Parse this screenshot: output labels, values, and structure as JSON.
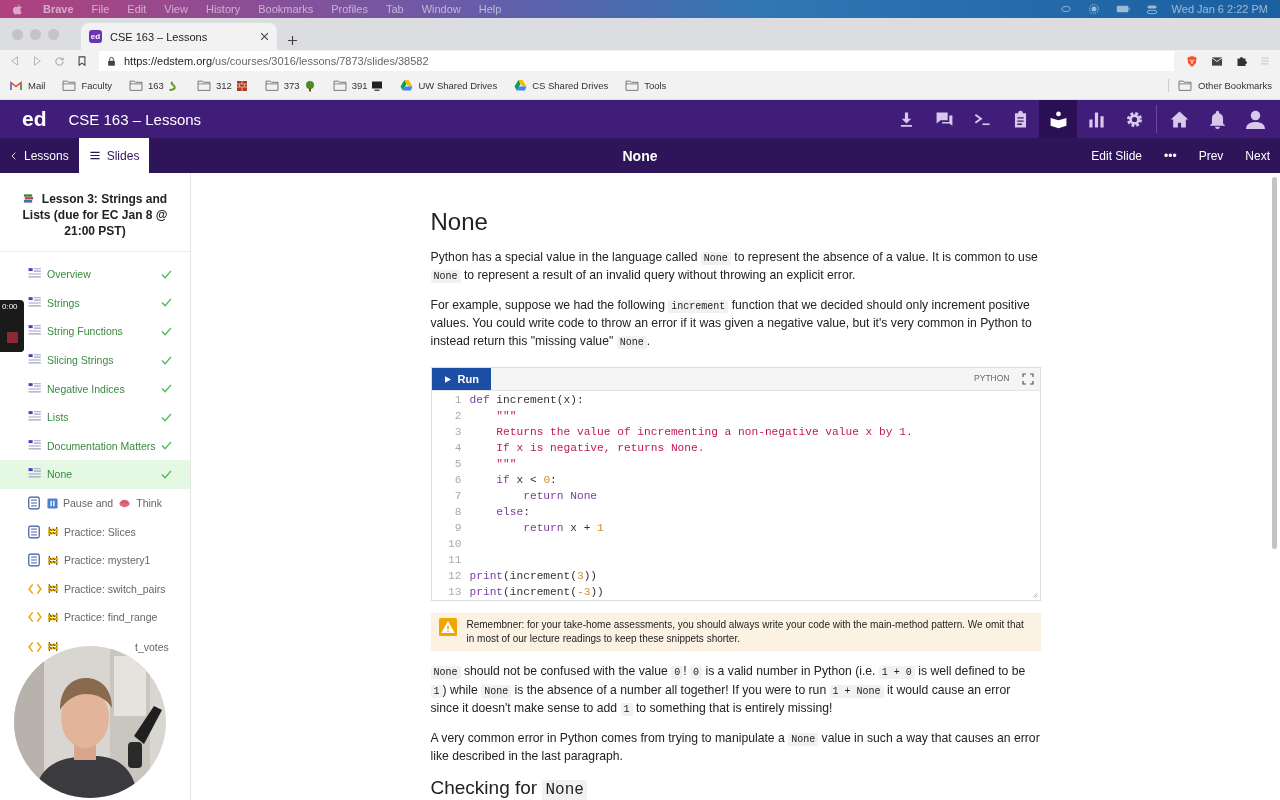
{
  "menu_bar": {
    "app": "Brave",
    "menus": [
      "File",
      "Edit",
      "View",
      "History",
      "Bookmarks",
      "Profiles",
      "Tab",
      "Window",
      "Help"
    ],
    "clock": "Wed Jan 6  2:22 PM"
  },
  "browser": {
    "tab": {
      "favicon": "ed",
      "title": "CSE 163 – Lessons"
    },
    "url_host": "https://edstem.org",
    "url_path": "/us/courses/3016/lessons/7873/slides/38582",
    "bookmarks": [
      {
        "kind": "gmail",
        "label": "Mail"
      },
      {
        "kind": "folder",
        "label": "Faculty"
      },
      {
        "kind": "snake_folder",
        "label": "163"
      },
      {
        "kind": "bricks_folder",
        "label": "312"
      },
      {
        "kind": "tree_folder",
        "label": "373"
      },
      {
        "kind": "monitor_folder",
        "label": "391"
      },
      {
        "kind": "drive",
        "label": "UW Shared Drives"
      },
      {
        "kind": "drive",
        "label": "CS Shared Drives"
      },
      {
        "kind": "folder",
        "label": "Tools"
      }
    ],
    "other_bookmarks": "Other Bookmarks"
  },
  "app_header": {
    "logo": "ed",
    "title": "CSE 163 – Lessons",
    "tools": [
      {
        "kind": "download",
        "selected": false
      },
      {
        "kind": "chat",
        "selected": false
      },
      {
        "kind": "terminal",
        "selected": false
      },
      {
        "kind": "clipboard",
        "selected": false
      },
      {
        "kind": "lessons",
        "selected": true
      },
      {
        "kind": "chart",
        "selected": false
      },
      {
        "kind": "settings",
        "selected": false
      },
      {
        "kind": "home",
        "selected": false
      },
      {
        "kind": "bell",
        "selected": false
      },
      {
        "kind": "user",
        "selected": false
      }
    ]
  },
  "subnav": {
    "back": "Lessons",
    "slides": {
      "label": "Slides",
      "selected": true
    },
    "title": "None",
    "actions": [
      "Edit Slide",
      "•••",
      "Prev",
      "Next"
    ]
  },
  "sidebar": {
    "title": "Lesson 3: Strings and Lists (due for EC Jan 8 @ 21:00 PST)",
    "items": [
      {
        "kind": "slide",
        "parts": [
          {
            "kind": "text",
            "text": "Overview"
          }
        ],
        "done": true,
        "selected": false
      },
      {
        "kind": "slide",
        "parts": [
          {
            "kind": "text",
            "text": "Strings"
          }
        ],
        "done": true,
        "selected": false
      },
      {
        "kind": "slide",
        "parts": [
          {
            "kind": "text",
            "text": "String Functions"
          }
        ],
        "done": true,
        "selected": false
      },
      {
        "kind": "slide",
        "parts": [
          {
            "kind": "text",
            "text": "Slicing Strings"
          }
        ],
        "done": true,
        "selected": false
      },
      {
        "kind": "slide",
        "parts": [
          {
            "kind": "text",
            "text": "Negative Indices"
          }
        ],
        "done": true,
        "selected": false
      },
      {
        "kind": "slide",
        "parts": [
          {
            "kind": "text",
            "text": "Lists"
          }
        ],
        "done": true,
        "selected": false
      },
      {
        "kind": "slide",
        "parts": [
          {
            "kind": "text",
            "text": "Documentation Matters"
          }
        ],
        "done": true,
        "selected": false
      },
      {
        "kind": "slide",
        "parts": [
          {
            "kind": "text",
            "text": "None"
          }
        ],
        "done": true,
        "selected": true
      },
      {
        "kind": "quiz",
        "parts": [
          {
            "kind": "pause"
          },
          {
            "kind": "text",
            "text": "Pause and"
          },
          {
            "kind": "brain"
          },
          {
            "kind": "text",
            "text": "Think"
          }
        ],
        "done": false,
        "selected": false
      },
      {
        "kind": "quiz",
        "parts": [
          {
            "kind": "barrier"
          },
          {
            "kind": "text",
            "text": "Practice: Slices"
          }
        ],
        "done": false,
        "selected": false
      },
      {
        "kind": "quiz",
        "parts": [
          {
            "kind": "barrier"
          },
          {
            "kind": "text",
            "text": "Practice: mystery1"
          }
        ],
        "done": false,
        "selected": false
      },
      {
        "kind": "code",
        "parts": [
          {
            "kind": "barrier"
          },
          {
            "kind": "text",
            "text": "Practice: switch_pairs"
          }
        ],
        "done": false,
        "selected": false
      },
      {
        "kind": "code",
        "parts": [
          {
            "kind": "barrier"
          },
          {
            "kind": "text",
            "text": "Practice: find_range"
          }
        ],
        "done": false,
        "selected": false
      },
      {
        "kind": "code",
        "parts": [
          {
            "kind": "barrier"
          },
          {
            "kind": "gap"
          },
          {
            "kind": "text",
            "text": "t_votes"
          }
        ],
        "done": false,
        "selected": false
      }
    ]
  },
  "recorder": {
    "time": "0:00"
  },
  "content": {
    "heading": "None",
    "blocks": [
      {
        "kind": "paragraph",
        "segments": [
          {
            "kind": "text",
            "text": "Python has a special value in the language called "
          },
          {
            "kind": "code",
            "text": "None"
          },
          {
            "kind": "text",
            "text": " to represent the absence of a value. It is common to use "
          },
          {
            "kind": "code",
            "text": "None"
          },
          {
            "kind": "text",
            "text": " to represent a result of an invalid query without throwing an explicit error."
          }
        ]
      },
      {
        "kind": "paragraph",
        "segments": [
          {
            "kind": "text",
            "text": "For example, suppose we had the following "
          },
          {
            "kind": "code",
            "text": "increment"
          },
          {
            "kind": "text",
            "text": " function that we decided should only increment positive values. You could write code to throw an error if it was given a negative value, but it's very common in Python to instead return this \"missing value\" "
          },
          {
            "kind": "code",
            "text": "None"
          },
          {
            "kind": "text",
            "text": "."
          }
        ]
      },
      {
        "kind": "code",
        "run": "Run",
        "language": "PYTHON",
        "lines": [
          {
            "number": "1",
            "tokens": [
              {
                "kind": "keyword",
                "text": "def"
              },
              {
                "kind": "plain",
                "text": " increment(x):"
              }
            ]
          },
          {
            "number": "2",
            "tokens": [
              {
                "kind": "string",
                "text": "    \"\"\""
              }
            ]
          },
          {
            "number": "3",
            "tokens": [
              {
                "kind": "string",
                "text": "    Returns the value of incrementing a non-negative value x by 1."
              }
            ]
          },
          {
            "number": "4",
            "tokens": [
              {
                "kind": "string",
                "text": "    If x is negative, returns None."
              }
            ]
          },
          {
            "number": "5",
            "tokens": [
              {
                "kind": "string",
                "text": "    \"\"\""
              }
            ]
          },
          {
            "number": "6",
            "tokens": [
              {
                "kind": "keyword",
                "text": "    if"
              },
              {
                "kind": "plain",
                "text": " x < "
              },
              {
                "kind": "number",
                "text": "0"
              },
              {
                "kind": "plain",
                "text": ":"
              }
            ]
          },
          {
            "number": "7",
            "tokens": [
              {
                "kind": "keyword",
                "text": "        return None"
              }
            ]
          },
          {
            "number": "8",
            "tokens": [
              {
                "kind": "keyword",
                "text": "    else"
              },
              {
                "kind": "plain",
                "text": ":"
              }
            ]
          },
          {
            "number": "9",
            "tokens": [
              {
                "kind": "keyword",
                "text": "        return"
              },
              {
                "kind": "plain",
                "text": " x + "
              },
              {
                "kind": "number",
                "text": "1"
              }
            ]
          },
          {
            "number": "10"
          },
          {
            "number": "11"
          },
          {
            "number": "12",
            "tokens": [
              {
                "kind": "keyword",
                "text": "print"
              },
              {
                "kind": "plain",
                "text": "(increment("
              },
              {
                "kind": "number",
                "text": "3"
              },
              {
                "kind": "plain",
                "text": "))"
              }
            ]
          },
          {
            "number": "13",
            "tokens": [
              {
                "kind": "keyword",
                "text": "print"
              },
              {
                "kind": "plain",
                "text": "(increment("
              },
              {
                "kind": "number",
                "text": "-3"
              },
              {
                "kind": "plain",
                "text": "))"
              }
            ]
          }
        ]
      },
      {
        "kind": "callout",
        "text": "Remembner: for your take-home assessments, you should always write your code with the main-method pattern. We omit that in most of our lecture readings to keep these snippets shorter."
      },
      {
        "kind": "paragraph",
        "segments": [
          {
            "kind": "code",
            "text": "None"
          },
          {
            "kind": "text",
            "text": " should not be confused with the value "
          },
          {
            "kind": "code",
            "text": "0"
          },
          {
            "kind": "text",
            "text": "! "
          },
          {
            "kind": "code",
            "text": "0"
          },
          {
            "kind": "text",
            "text": " is a valid number in Python (i.e. "
          },
          {
            "kind": "code",
            "text": "1 + 0"
          },
          {
            "kind": "text",
            "text": " is well defined to be "
          },
          {
            "kind": "code",
            "text": "1"
          },
          {
            "kind": "text",
            "text": ") while "
          },
          {
            "kind": "code",
            "text": "None"
          },
          {
            "kind": "text",
            "text": " is the absence of a number all together! If you were to run "
          },
          {
            "kind": "code",
            "text": "1 + None"
          },
          {
            "kind": "text",
            "text": " it would cause an error since it doesn't make sense to add "
          },
          {
            "kind": "code",
            "text": "1"
          },
          {
            "kind": "text",
            "text": " to something that is entirely missing!"
          }
        ]
      },
      {
        "kind": "paragraph",
        "segments": [
          {
            "kind": "text",
            "text": "A very common error in Python comes from trying to manipulate a "
          },
          {
            "kind": "code",
            "text": "None"
          },
          {
            "kind": "text",
            "text": " value in such a way that causes an error like described in the last paragraph."
          }
        ]
      },
      {
        "kind": "heading",
        "segments": [
          {
            "kind": "text",
            "text": "Checking for "
          },
          {
            "kind": "code",
            "text": "None"
          }
        ]
      }
    ]
  }
}
